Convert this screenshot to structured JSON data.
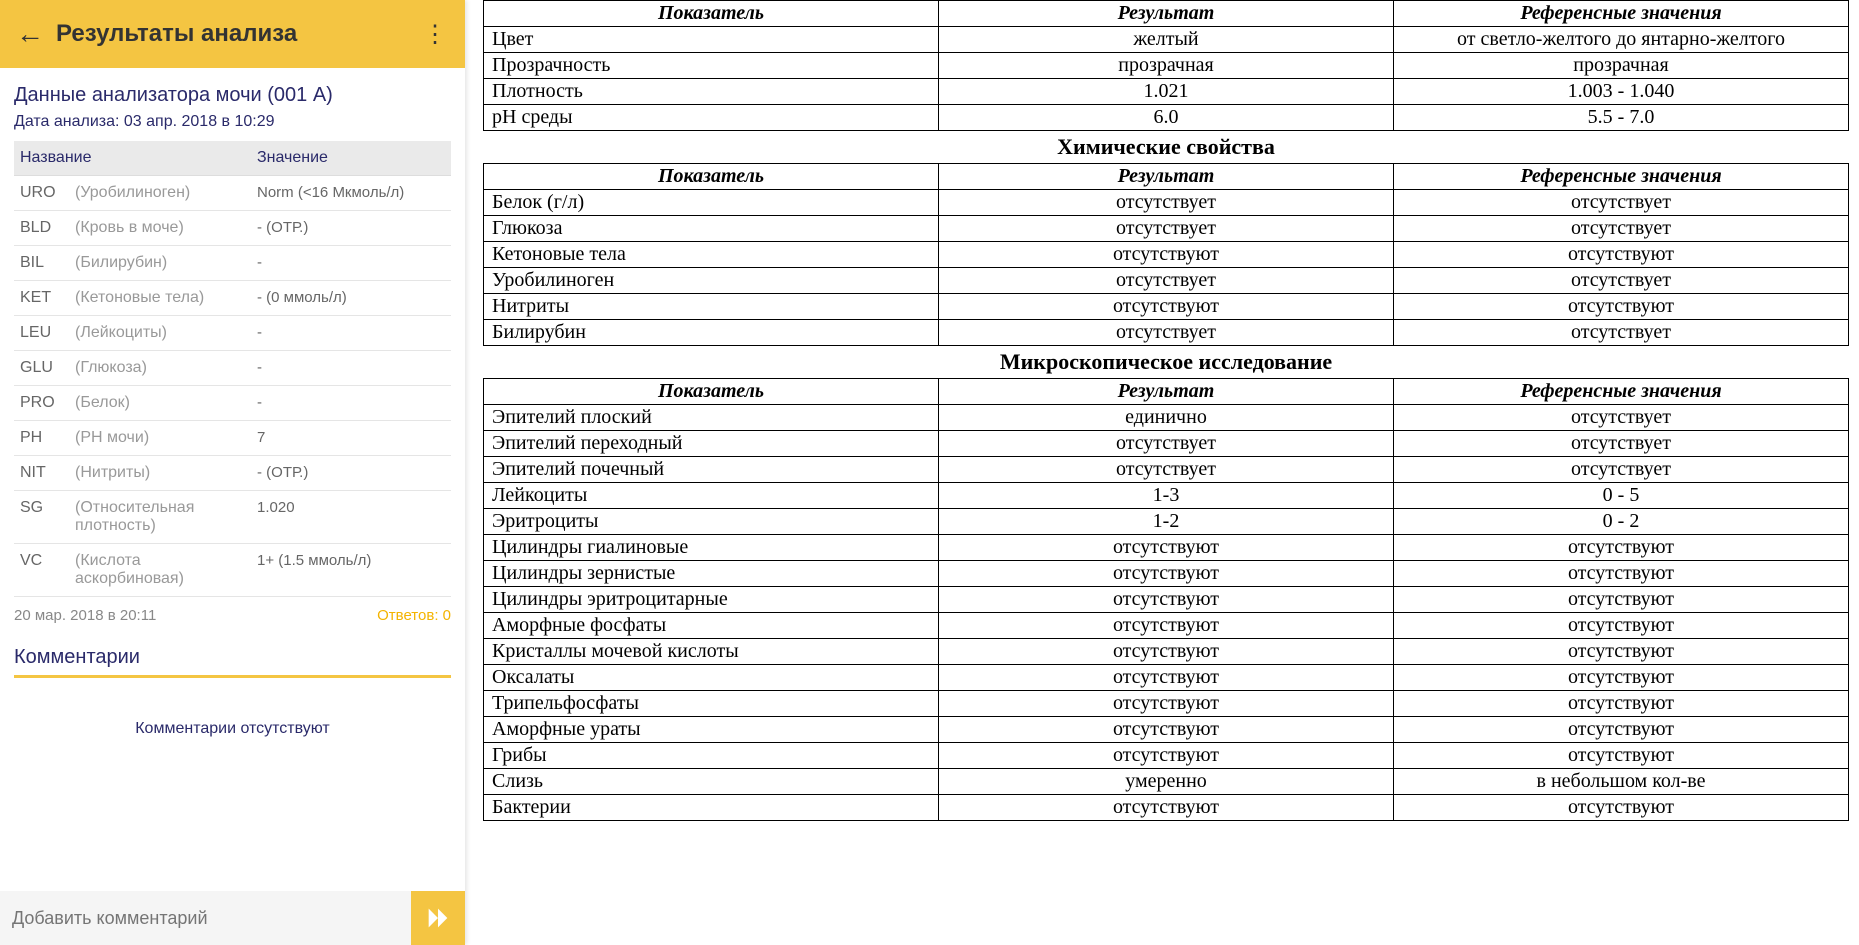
{
  "appbar": {
    "title": "Результаты анализа"
  },
  "left": {
    "header_title": "Данные анализатора мочи (001 А)",
    "date_line": "Дата анализа: 03 апр. 2018 в 10:29",
    "col_name": "Название",
    "col_value": "Значение",
    "rows": [
      {
        "code": "URO",
        "desc": "(Уробилиноген)",
        "val": "Norm (<16 Мкмоль/л)"
      },
      {
        "code": "BLD",
        "desc": "(Кровь в моче)",
        "val": "- (ОТР.)"
      },
      {
        "code": "BIL",
        "desc": "(Билирубин)",
        "val": "-"
      },
      {
        "code": "KET",
        "desc": "(Кетоновые тела)",
        "val": "- (0 ммоль/л)"
      },
      {
        "code": "LEU",
        "desc": "(Лейкоциты)",
        "val": "-"
      },
      {
        "code": "GLU",
        "desc": "(Глюкоза)",
        "val": "-"
      },
      {
        "code": "PRO",
        "desc": "(Белок)",
        "val": "-"
      },
      {
        "code": "PH",
        "desc": "(PH мочи)",
        "val": "7"
      },
      {
        "code": "NIT",
        "desc": "(Нитриты)",
        "val": "- (ОТР.)"
      },
      {
        "code": "SG",
        "desc": "(Относительная плотность)",
        "val": "1.020"
      },
      {
        "code": "VC",
        "desc": "(Кислота аскорбиновая)",
        "val": "1+ (1.5 ммоль/л)"
      }
    ],
    "footer_ts": "20 мар. 2018 в 20:11",
    "footer_answers": "Ответов: 0",
    "comments_title": "Комментарии",
    "no_comments": "Комментарии отсутствуют",
    "comment_placeholder": "Добавить комментарий"
  },
  "right": {
    "cols": {
      "indicator": "Показатель",
      "result": "Результат",
      "reference": "Референсные значения"
    },
    "physical": {
      "rows": [
        {
          "i": "Цвет",
          "r": "желтый",
          "ref": "от светло-желтого до янтарно-желтого"
        },
        {
          "i": "Прозрачность",
          "r": "прозрачная",
          "ref": "прозрачная"
        },
        {
          "i": "Плотность",
          "r": "1.021",
          "ref": "1.003 - 1.040"
        },
        {
          "i": "pH среды",
          "r": "6.0",
          "ref": "5.5 - 7.0"
        }
      ]
    },
    "chemical": {
      "title": "Химические свойства",
      "rows": [
        {
          "i": "Белок (г/л)",
          "r": "отсутствует",
          "ref": "отсутствует"
        },
        {
          "i": "Глюкоза",
          "r": "отсутствует",
          "ref": "отсутствует"
        },
        {
          "i": "Кетоновые тела",
          "r": "отсутствуют",
          "ref": "отсутствуют"
        },
        {
          "i": "Уробилиноген",
          "r": "отсутствует",
          "ref": "отсутствует"
        },
        {
          "i": "Нитриты",
          "r": "отсутствуют",
          "ref": "отсутствуют"
        },
        {
          "i": "Билирубин",
          "r": "отсутствует",
          "ref": "отсутствует"
        }
      ]
    },
    "microscopy": {
      "title": "Микроскопическое исследование",
      "rows": [
        {
          "i": "Эпителий плоский",
          "r": "единично",
          "ref": "отсутствует"
        },
        {
          "i": "Эпителий переходный",
          "r": "отсутствует",
          "ref": "отсутствует"
        },
        {
          "i": "Эпителий почечный",
          "r": "отсутствует",
          "ref": "отсутствует"
        },
        {
          "i": "Лейкоциты",
          "r": "1-3",
          "ref": "0 - 5"
        },
        {
          "i": "Эритроциты",
          "r": "1-2",
          "ref": "0 - 2"
        },
        {
          "i": "Цилиндры гиалиновые",
          "r": "отсутствуют",
          "ref": "отсутствуют"
        },
        {
          "i": "Цилиндры зернистые",
          "r": "отсутствуют",
          "ref": "отсутствуют"
        },
        {
          "i": "Цилиндры эритроцитарные",
          "r": "отсутствуют",
          "ref": "отсутствуют"
        },
        {
          "i": "Аморфные фосфаты",
          "r": "отсутствуют",
          "ref": "отсутствуют"
        },
        {
          "i": "Кристаллы мочевой кислоты",
          "r": "отсутствуют",
          "ref": "отсутствуют"
        },
        {
          "i": "Оксалаты",
          "r": "отсутствуют",
          "ref": "отсутствуют"
        },
        {
          "i": "Трипельфосфаты",
          "r": "отсутствуют",
          "ref": "отсутствуют"
        },
        {
          "i": "Аморфные ураты",
          "r": "отсутствуют",
          "ref": "отсутствуют"
        },
        {
          "i": "Грибы",
          "r": "отсутствуют",
          "ref": "отсутствуют"
        },
        {
          "i": "Слизь",
          "r": "умеренно",
          "ref": "в небольшом кол-ве"
        },
        {
          "i": "Бактерии",
          "r": "отсутствуют",
          "ref": "отсутствуют"
        }
      ]
    }
  }
}
